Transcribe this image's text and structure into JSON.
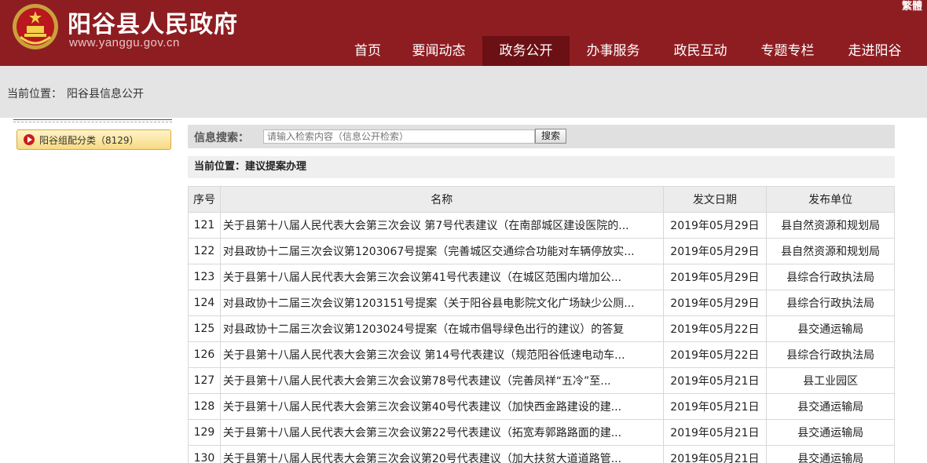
{
  "header": {
    "title": "阳谷县人民政府",
    "url": "www.yanggu.gov.cn",
    "lang_link": "繁體",
    "nav": [
      "首页",
      "要闻动态",
      "政务公开",
      "办事服务",
      "政民互动",
      "专题专栏",
      "走进阳谷"
    ],
    "active_nav": "政务公开",
    "accent_color": "#8e1d22"
  },
  "breadcrumb": {
    "label": "当前位置：",
    "path": "阳谷县信息公开"
  },
  "sidebar": {
    "category_button": "阳谷组配分类（8129）"
  },
  "search": {
    "label": "信息搜索：",
    "placeholder": "请输入检索内容（信息公开检索）",
    "button": "搜索"
  },
  "sub_breadcrumb": "当前位置：建议提案办理",
  "table": {
    "headers": [
      "序号",
      "名称",
      "发文日期",
      "发布单位"
    ],
    "rows": [
      {
        "no": "121",
        "name": "关于县第十八届人民代表大会第三次会议 第7号代表建议（在南部城区建设医院的...",
        "date": "2019年05月29日",
        "unit": "县自然资源和规划局"
      },
      {
        "no": "122",
        "name": "对县政协十二届三次会议第1203067号提案（完善城区交通综合功能对车辆停放实...",
        "date": "2019年05月29日",
        "unit": "县自然资源和规划局"
      },
      {
        "no": "123",
        "name": "关于县第十八届人民代表大会第三次会议第41号代表建议（在城区范围内增加公...",
        "date": "2019年05月29日",
        "unit": "县综合行政执法局"
      },
      {
        "no": "124",
        "name": "对县政协十二届三次会议第1203151号提案（关于阳谷县电影院文化广场缺少公厕...",
        "date": "2019年05月29日",
        "unit": "县综合行政执法局"
      },
      {
        "no": "125",
        "name": "对县政协十二届三次会议第1203024号提案（在城市倡导绿色出行的建议）的答复",
        "date": "2019年05月22日",
        "unit": "县交通运输局"
      },
      {
        "no": "126",
        "name": "关于县第十八届人民代表大会第三次会议 第14号代表建议（规范阳谷低速电动车...",
        "date": "2019年05月22日",
        "unit": "县综合行政执法局"
      },
      {
        "no": "127",
        "name": "关于县第十八届人民代表大会第三次会议第78号代表建议（完善凤祥“五冷”至...",
        "date": "2019年05月21日",
        "unit": "县工业园区"
      },
      {
        "no": "128",
        "name": "关于县第十八届人民代表大会第三次会议第40号代表建议（加快西金路建设的建...",
        "date": "2019年05月21日",
        "unit": "县交通运输局"
      },
      {
        "no": "129",
        "name": "关于县第十八届人民代表大会第三次会议第22号代表建议（拓宽寿郭路路面的建...",
        "date": "2019年05月21日",
        "unit": "县交通运输局"
      },
      {
        "no": "130",
        "name": "关于县第十八届人民代表大会第三次会议第20号代表建议（加大扶贫大道道路管...",
        "date": "2019年05月21日",
        "unit": "县交通运输局"
      }
    ]
  }
}
